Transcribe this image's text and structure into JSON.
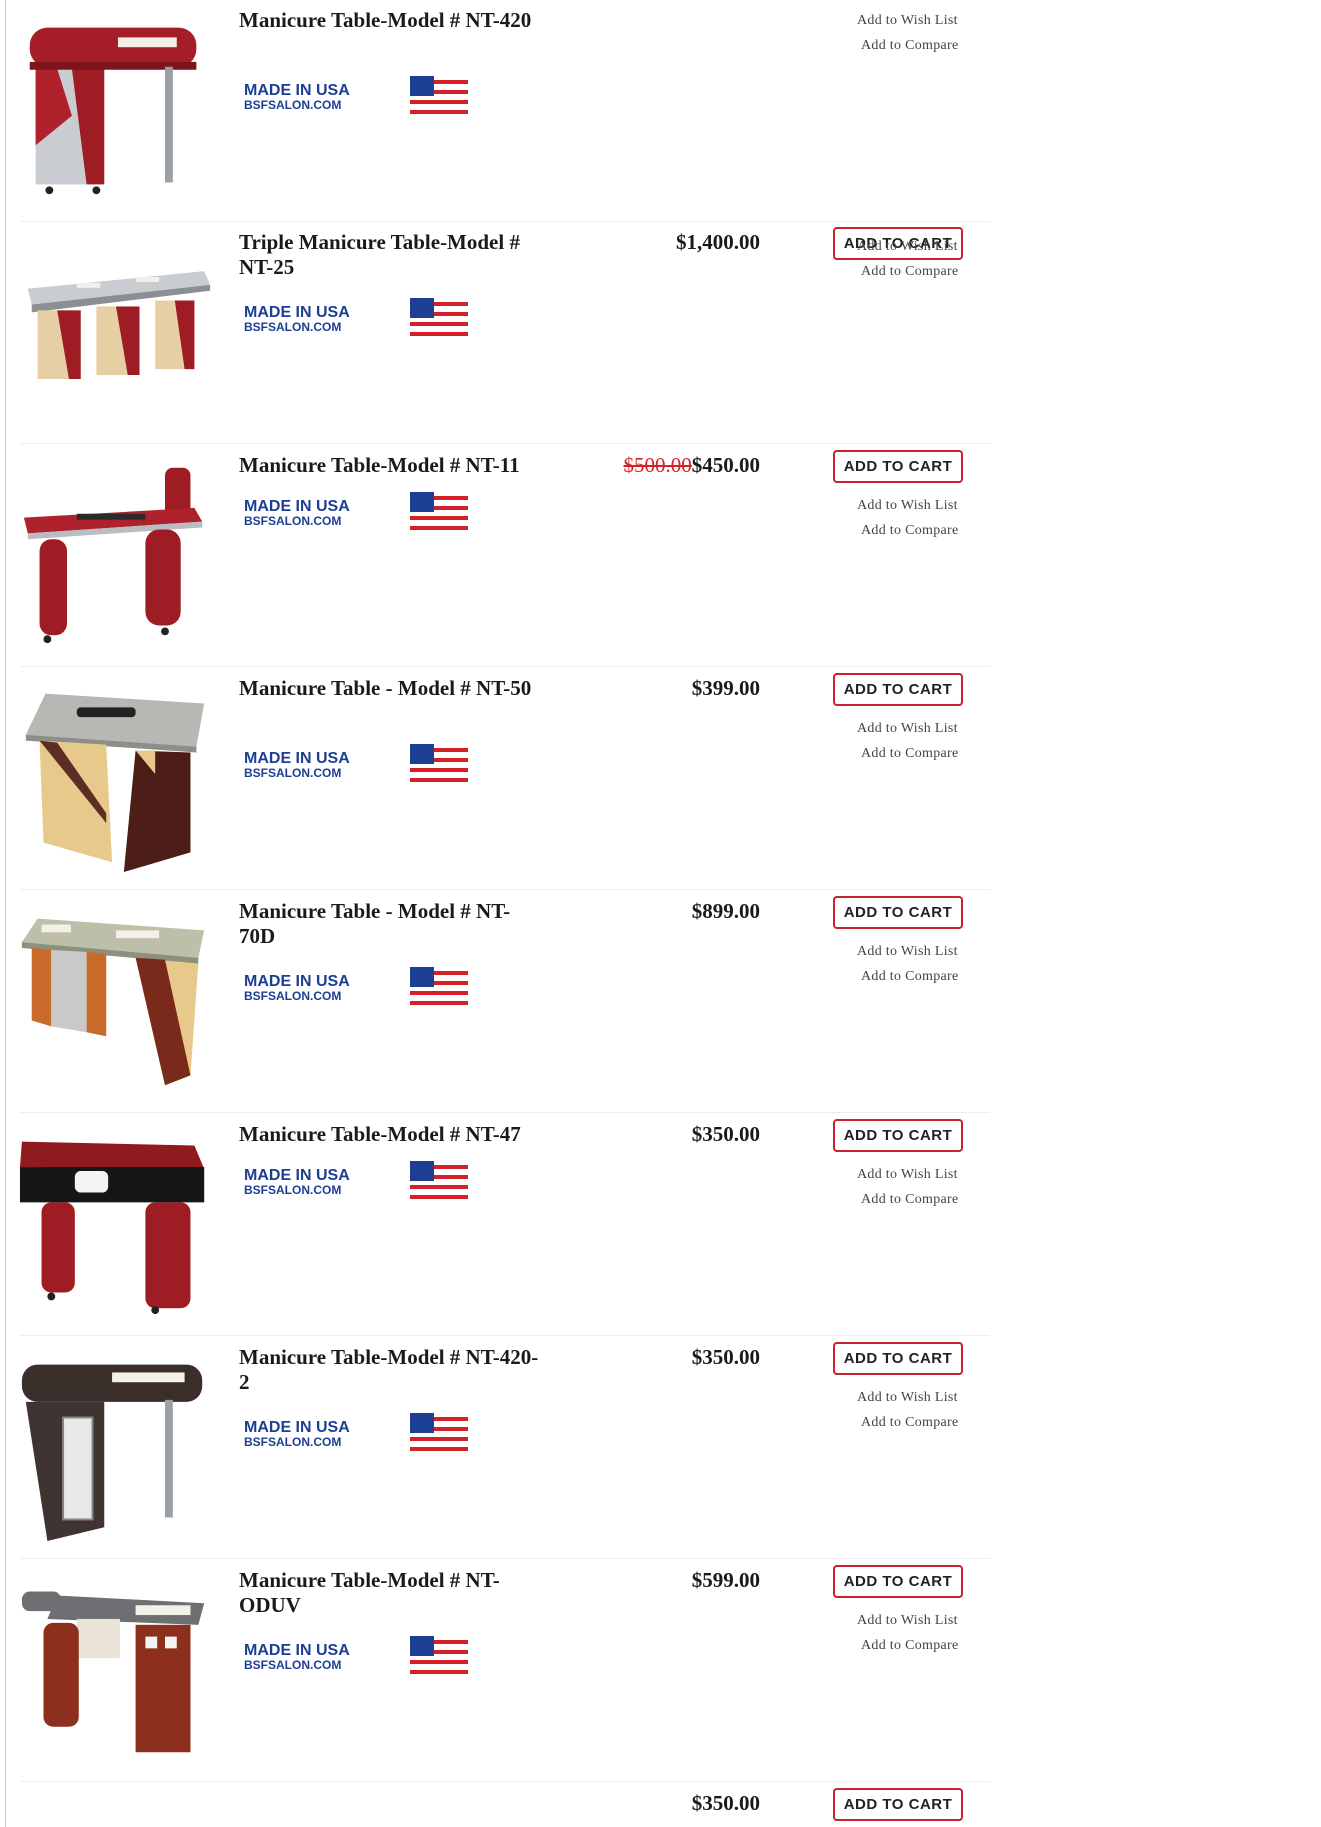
{
  "products": [
    {
      "title": "Manicure Table-Model # NT-420",
      "old_price": "",
      "price": "",
      "cart_label": "",
      "wish_label": "Add to Wish List",
      "compare_label": "Add to Compare",
      "badge_text": "MADE IN USA",
      "badge_sub": "BSFSALON.COM"
    },
    {
      "title": "Triple Manicure Table-Model # NT-25",
      "old_price": "",
      "price": "$1,400.00",
      "cart_label": "ADD TO CART",
      "wish_label": "Add to Wish List",
      "compare_label": "Add to Compare",
      "badge_text": "MADE IN USA",
      "badge_sub": "BSFSALON.COM"
    },
    {
      "title": "Manicure Table-Model # NT-11",
      "old_price": "$500.00",
      "price": "$450.00",
      "cart_label": "ADD TO CART",
      "wish_label": "Add to Wish List",
      "compare_label": "Add to Compare",
      "badge_text": "MADE IN USA",
      "badge_sub": "BSFSALON.COM"
    },
    {
      "title": "Manicure Table - Model # NT-50",
      "old_price": "",
      "price": "$399.00",
      "cart_label": "ADD TO CART",
      "wish_label": "Add to Wish List",
      "compare_label": "Add to Compare",
      "badge_text": "MADE IN USA",
      "badge_sub": "BSFSALON.COM"
    },
    {
      "title": "Manicure Table - Model # NT-70D",
      "old_price": "",
      "price": "$899.00",
      "cart_label": "ADD TO CART",
      "wish_label": "Add to Wish List",
      "compare_label": "Add to Compare",
      "badge_text": "MADE IN USA",
      "badge_sub": "BSFSALON.COM"
    },
    {
      "title": "Manicure Table-Model # NT-47",
      "old_price": "",
      "price": "$350.00",
      "cart_label": "ADD TO CART",
      "wish_label": "Add to Wish List",
      "compare_label": "Add to Compare",
      "badge_text": "MADE IN USA",
      "badge_sub": "BSFSALON.COM"
    },
    {
      "title": "Manicure Table-Model # NT-420-2",
      "old_price": "",
      "price": "$350.00",
      "cart_label": "ADD TO CART",
      "wish_label": "Add to Wish List",
      "compare_label": "Add to Compare",
      "badge_text": "MADE IN USA",
      "badge_sub": "BSFSALON.COM"
    },
    {
      "title": "Manicure Table-Model # NT-ODUV",
      "old_price": "",
      "price": "$599.00",
      "cart_label": "ADD TO CART",
      "wish_label": "Add to Wish List",
      "compare_label": "Add to Compare",
      "badge_text": "MADE IN USA",
      "badge_sub": "BSFSALON.COM"
    },
    {
      "title": "",
      "old_price": "",
      "price": "$350.00",
      "cart_label": "ADD TO CART",
      "wish_label": "",
      "compare_label": "",
      "badge_text": "",
      "badge_sub": ""
    }
  ],
  "colors": {
    "cart_border": "#c8232c",
    "old_price": "#d42127"
  }
}
